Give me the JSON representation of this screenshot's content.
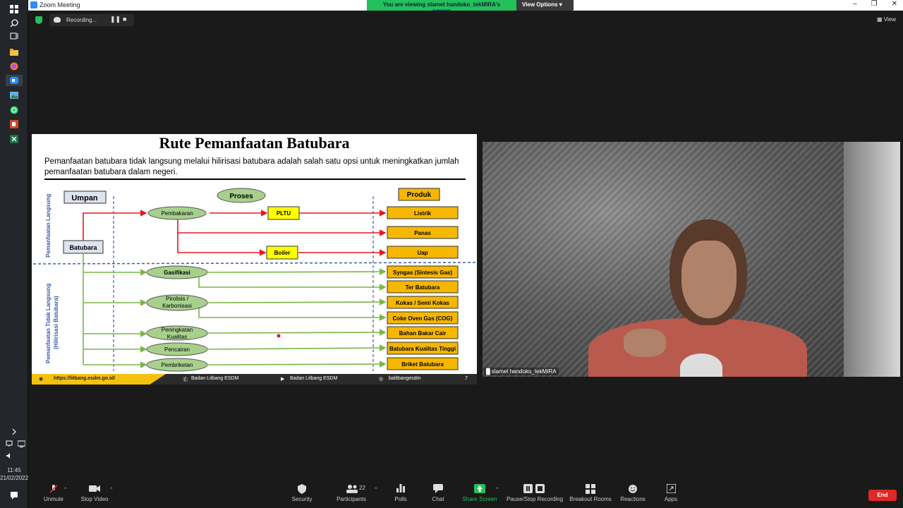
{
  "window": {
    "title": "Zoom Meeting",
    "share_message": "You are viewing slamet handoko_tekMIRA's screen",
    "view_options": "View Options",
    "view_label": "View"
  },
  "recording": {
    "label": "Recording..."
  },
  "taskbar": {
    "time": "11:45",
    "date": "21/02/2022"
  },
  "slide": {
    "title": "Rute Pemanfaatan Batubara",
    "description": "Pemanfaatan batubara tidak langsung melalui hilirisasi batubara adalah salah satu opsi untuk meningkatkan jumlah pemanfaatan batubara dalam negeri.",
    "labels": {
      "umpan": "Umpan",
      "proses": "Proses",
      "produk": "Produk",
      "batubara": "Batubara",
      "direct": "Pemanfaatan Langsung",
      "indirect_1": "Pemanfaatan Tidak Langsung",
      "indirect_2": "(Hilirisasi Batubara)"
    },
    "processes": {
      "pembakaran": "Pembakaran",
      "pltu": "PLTU",
      "boiler": "Boiler",
      "gasifikasi": "Gasifikasi",
      "pirolisis_1": "Pirolisis /",
      "pirolisis_2": "Karbonisasi",
      "peningkatan_1": "Peningkatan",
      "peningkatan_2": "Kualitas",
      "pencairan": "Pencairan",
      "pembriketan": "Pembriketan"
    },
    "products": {
      "listrik": "Listrik",
      "panas": "Panas",
      "uap": "Uap",
      "syngas": "Syngas (Sintesis Gas)",
      "ter": "Ter Batubara",
      "kokas": "Kokas / Semi Kokas",
      "coke_oven": "Coke Oven Gas (COG)",
      "bahan_bakar": "Bahan Bakar Cair",
      "kualitas_tinggi": "Batubara Kualitas Tinggi",
      "briket": "Briket Batubara"
    },
    "footer": {
      "url": "https://litbang.esdm.go.id/",
      "facebook": "Badan Litbang ESDM",
      "youtube": "Badan Litbang ESDM",
      "instagram": "balitbangesdm",
      "page": "7"
    }
  },
  "video": {
    "name": "slamet handoko_tekMIRA"
  },
  "toolbar": {
    "unmute": "Unmute",
    "stop_video": "Stop Video",
    "security": "Security",
    "participants": "Participants",
    "participants_count": "22",
    "polls": "Polls",
    "chat": "Chat",
    "share_screen": "Share Screen",
    "pause_stop_recording": "Pause/Stop Recording",
    "breakout_rooms": "Breakout Rooms",
    "reactions": "Reactions",
    "apps": "Apps",
    "end": "End"
  }
}
